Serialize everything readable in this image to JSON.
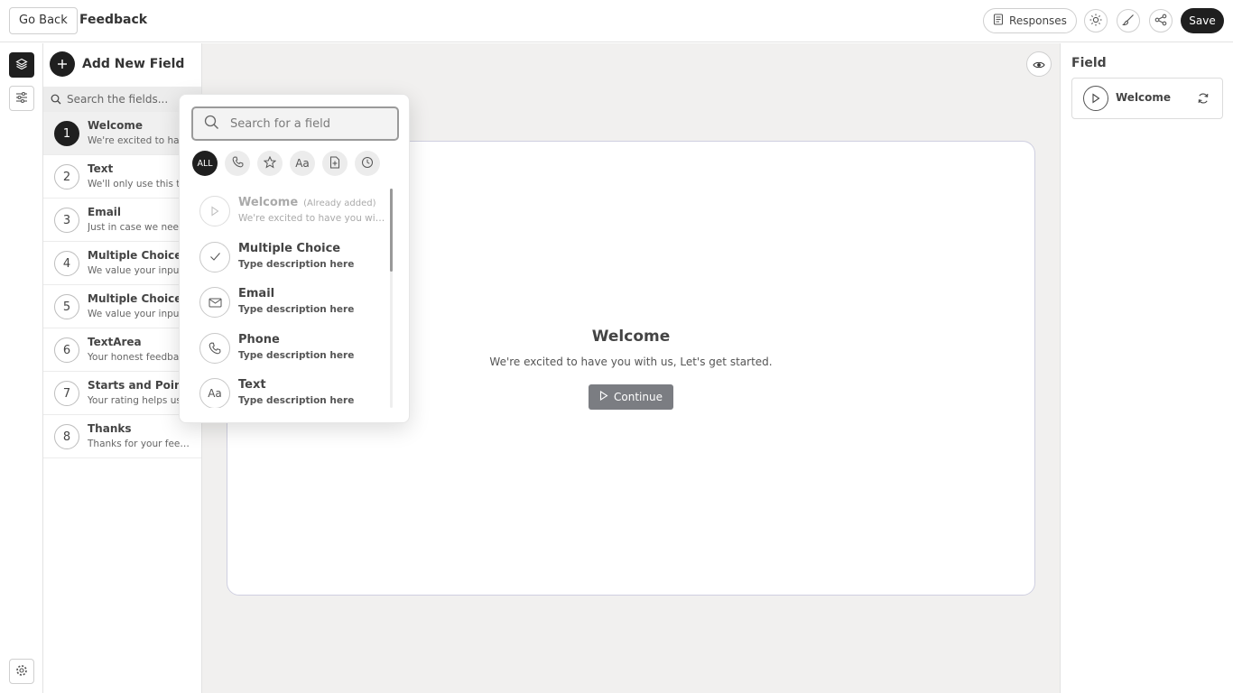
{
  "header": {
    "back_label": "Go Back",
    "title": "Feedback",
    "responses_label": "Responses",
    "save_label": "Save"
  },
  "field_list": {
    "add_label": "Add New Field",
    "search_placeholder": "Search the fields...",
    "items": [
      {
        "num": "1",
        "title": "Welcome",
        "desc": "We're excited to have you with us"
      },
      {
        "num": "2",
        "title": "Text",
        "desc": "We'll only use this to contact you"
      },
      {
        "num": "3",
        "title": "Email",
        "desc": "Just in case we need to reach you"
      },
      {
        "num": "4",
        "title": "Multiple Choice",
        "desc": "We value your input on this"
      },
      {
        "num": "5",
        "title": "Multiple Choice",
        "desc": "We value your input on this"
      },
      {
        "num": "6",
        "title": "TextArea",
        "desc": "Your honest feedback helps us"
      },
      {
        "num": "7",
        "title": "Starts and Points",
        "desc": "Your rating helps us improve"
      },
      {
        "num": "8",
        "title": "Thanks",
        "desc": "Thanks for your feedback"
      }
    ]
  },
  "popup": {
    "search_placeholder": "Search for a field",
    "filter_all": "ALL",
    "options": [
      {
        "title": "Welcome",
        "tag": "(Already added)",
        "desc": "We're excited to have you with us"
      },
      {
        "title": "Multiple Choice",
        "desc": "Type description here"
      },
      {
        "title": "Email",
        "desc": "Type description here"
      },
      {
        "title": "Phone",
        "desc": "Type description here"
      },
      {
        "title": "Text",
        "desc": "Type description here"
      }
    ]
  },
  "canvas": {
    "title": "Welcome",
    "desc": "We're excited to have you with us, Let's get started.",
    "continue_label": "Continue"
  },
  "right_panel": {
    "title": "Field",
    "field_label": "Welcome"
  },
  "icons": {
    "text_type_glyph": "Aa"
  },
  "colors": {
    "primary": "#1f1f1f",
    "canvas_bg": "#f1f0ef",
    "continue_bg": "#7b7d82"
  }
}
